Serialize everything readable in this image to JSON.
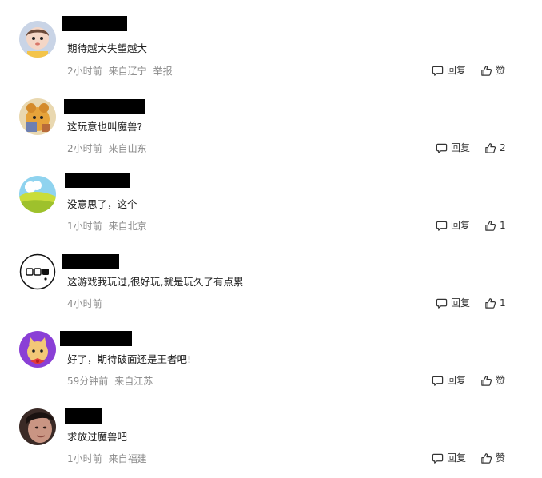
{
  "comments": [
    {
      "text": "期待越大失望越大",
      "time": "2小时前",
      "location": "来自辽宁",
      "report": "举报",
      "reply": "回复",
      "like": "赞"
    },
    {
      "text": "这玩意也叫魔兽?",
      "time": "2小时前",
      "location": "来自山东",
      "reply": "回复",
      "like": "2"
    },
    {
      "text": "没意思了，这个",
      "time": "1小时前",
      "location": "来自北京",
      "reply": "回复",
      "like": "1"
    },
    {
      "text": "这游戏我玩过,很好玩,就是玩久了有点累",
      "time": "4小时前",
      "reply": "回复",
      "like": "1"
    },
    {
      "text": "好了，期待破面还是王者吧!",
      "time": "59分钟前",
      "location": "来自江苏",
      "reply": "回复",
      "like": "赞"
    },
    {
      "text": "求放过魔兽吧",
      "time": "1小时前",
      "location": "来自福建",
      "reply": "回复",
      "like": "赞"
    }
  ],
  "colors": {
    "text": "#222222",
    "meta": "#8a8a8a",
    "redaction": "#000000"
  },
  "icons": {
    "reply": "speech-bubble-icon",
    "like": "thumbs-up-icon"
  }
}
